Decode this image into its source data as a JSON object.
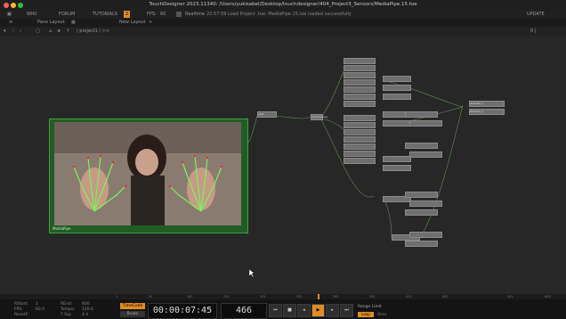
{
  "window": {
    "title": "TouchDesigner 2023.11340: /Users/yukisabel/Desktop/touchdesigner/404_Project3_Sensors/MediaPipe.15.toe"
  },
  "menubar": {
    "wiki": "WIKI",
    "forum": "FORUM",
    "tutorials": "TUTORIALS",
    "ai_badge": "2",
    "fps_label": "FPS:",
    "fps_value": "60",
    "realtime": "Realtime",
    "status_message": "22:57:59 Load Project .toe: MediaPipe.15.toe loaded successfully",
    "update": "UPDATE"
  },
  "toolbar": {
    "pane_layout": "Pane Layout",
    "new_layout": "New Layout"
  },
  "pathbar": {
    "path": "/ project1 / >>",
    "right_btn": "0 |"
  },
  "network": {
    "mediapipe_label": "MediaPipe",
    "nodes": [
      {
        "label": "null1"
      },
      {
        "label": "hand_tracking"
      },
      {
        "label": "hand_tracking"
      },
      {
        "label": "h_tracking2"
      },
      {
        "label": "landmark_1"
      },
      {
        "label": "landmark_2"
      }
    ]
  },
  "timeline": {
    "ticks": [
      "1",
      "91",
      "181",
      "211",
      "301",
      "331",
      "361",
      "391",
      "421",
      "451",
      "541",
      "600"
    ]
  },
  "stats": {
    "start_label": "Start:",
    "start_value": "1",
    "end_label": "End:",
    "end_value": "600",
    "rstart_label": "RStart:",
    "rstart_value": "1",
    "rend_label": "REnd:",
    "rend_value": "600",
    "fps_label": "FPS:",
    "fps_value": "60.0",
    "tempo_label": "Tempo:",
    "tempo_value": "120.0",
    "resetf_label": "ResetF:",
    "tsig_label": "T Sig:",
    "tsig_value": "4  4"
  },
  "transport": {
    "timecode_label": "TimeCode",
    "beats_label": "Beats",
    "timecode": "00:00:07:45",
    "frame": "466",
    "range_limit": "Range Limit",
    "loop": "Loop",
    "once": "Once"
  },
  "colors": {
    "accent": "#e08b24",
    "node_border_green": "#3a8a3a"
  }
}
